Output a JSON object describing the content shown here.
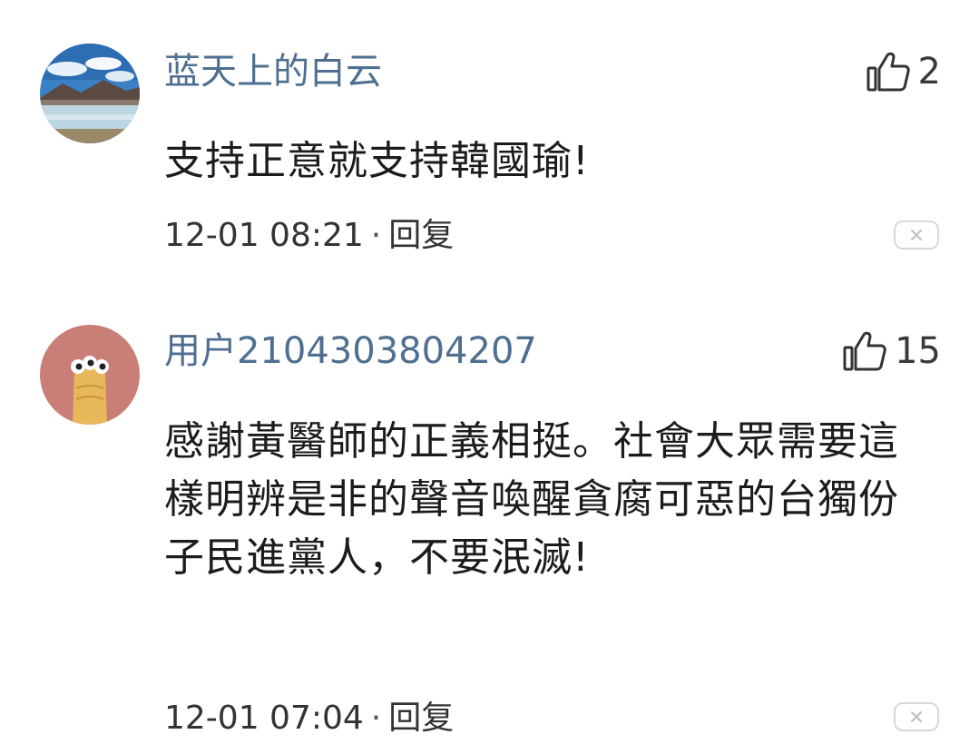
{
  "comments": [
    {
      "username": "蓝天上的白云",
      "likes": "2",
      "content": "支持正意就支持韓國瑜!",
      "time": "12-01 08:21",
      "separator": "·",
      "reply_label": "回复",
      "avatar_icon": "landscape-avatar-icon"
    },
    {
      "username": "用户2104303804207",
      "likes": "15",
      "content": "感謝黃醫師的正義相挺。社會大眾需要這樣明辨是非的聲音喚醒貪腐可惡的台獨份子民進黨人，不要泯滅!",
      "time": "12-01 07:04",
      "separator": "·",
      "reply_label": "回复",
      "avatar_icon": "cartoon-avatar-icon"
    }
  ],
  "icons": {
    "like": "thumbs-up-icon",
    "dismiss": "close-icon"
  },
  "colors": {
    "username": "#4f6f91",
    "content": "#1c1c1c",
    "meta": "#333333",
    "border": "#d8d8d8"
  }
}
